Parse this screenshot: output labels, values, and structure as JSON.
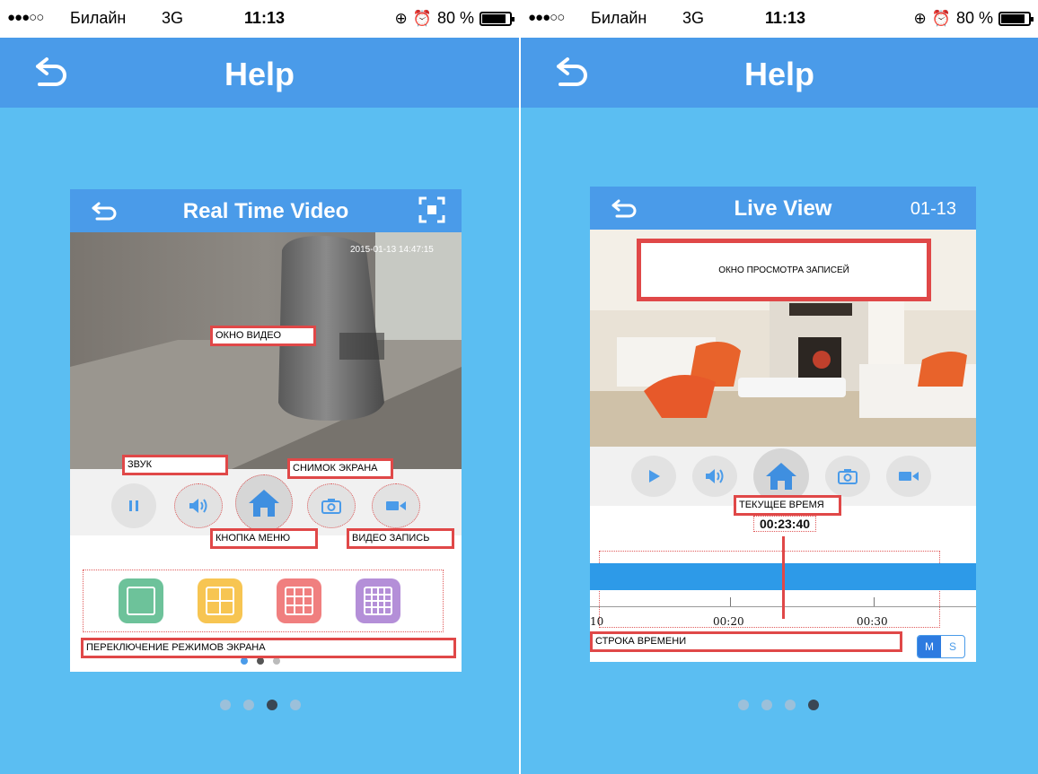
{
  "left_screen": {
    "status": {
      "signal": "●●●○○",
      "carrier": "Билайн",
      "network": "3G",
      "time": "11:13",
      "battery": "80 %",
      "battery_level": 0.8
    },
    "nav_title": "Help",
    "app": {
      "title": "Real Time Video",
      "video_timestamp": "2015-01-13 14:47:15",
      "labels": {
        "video_window": "ОКНО ВИДЕО",
        "sound": "ЗВУК",
        "snapshot": "СНИМОК ЭКРАНА",
        "menu_button": "КНОПКА МЕНЮ",
        "video_record": "ВИДЕО ЗАПИСЬ",
        "screen_modes": "ПЕРЕКЛЮЧЕНИЕ РЕЖИМОВ ЭКРАНА"
      },
      "layout_tiles": [
        {
          "name": "single-view",
          "color": "#6dc29a"
        },
        {
          "name": "quad-view",
          "color": "#f7c552"
        },
        {
          "name": "nine-view",
          "color": "#f07f7f"
        },
        {
          "name": "sixteen-view",
          "color": "#b48fd8"
        }
      ]
    },
    "page_dots": {
      "count": 4,
      "active": 2
    }
  },
  "right_screen": {
    "status": {
      "signal": "●●●○○",
      "carrier": "Билайн",
      "network": "3G",
      "time": "11:13",
      "battery": "80 %",
      "battery_level": 0.8
    },
    "nav_title": "Help",
    "app": {
      "title": "Live View",
      "date": "01-13",
      "current_time": "00:23:40",
      "labels": {
        "playback_window": "ОКНО ПРОСМОТРА ЗАПИСЕЙ",
        "current_time": "ТЕКУЩЕЕ ВРЕМЯ",
        "timeline": "СТРОКА ВРЕМЕНИ"
      },
      "ticks": [
        "10",
        "00:20",
        "00:30"
      ],
      "scale_toggle": [
        "M",
        "S"
      ],
      "scale_active": "M"
    },
    "page_dots": {
      "count": 4,
      "active": 3
    }
  },
  "colors": {
    "background": "#5bbef2",
    "navbar": "#4a9be9",
    "annotation": "#e04848",
    "timeline": "#2d9ae8"
  }
}
